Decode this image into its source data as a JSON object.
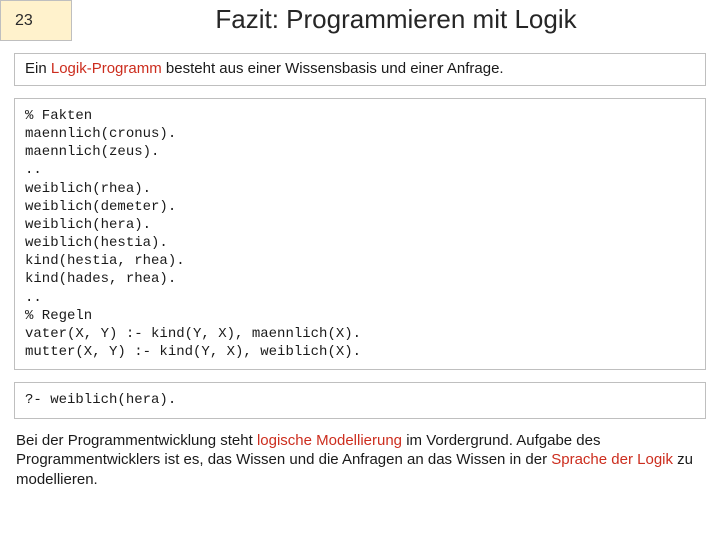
{
  "page_number": "23",
  "title": "Fazit: Programmieren mit Logik",
  "intro": {
    "pre": "Ein ",
    "hl": "Logik-Programm",
    "post": " besteht aus einer Wissensbasis und einer Anfrage."
  },
  "code": "% Fakten\nmaennlich(cronus).\nmaennlich(zeus).\n..\nweiblich(rhea).\nweiblich(demeter).\nweiblich(hera).\nweiblich(hestia).\nkind(hestia, rhea).\nkind(hades, rhea).\n..\n% Regeln\nvater(X, Y) :- kind(Y, X), maennlich(X).\nmutter(X, Y) :- kind(Y, X), weiblich(X).",
  "query": "?- weiblich(hera).",
  "para": {
    "t1": "Bei der Programmentwicklung steht ",
    "h1": "logische Modellierung",
    "t2": " im Vordergrund. Aufgabe des Programmentwicklers ist es, das Wissen und die Anfragen an das Wissen in der ",
    "h2": "Sprache der Logik",
    "t3": " zu modellieren."
  },
  "colors": {
    "highlight": "#cc2d1e",
    "page_box_bg": "#fff2cc",
    "border": "#bfbfbf"
  }
}
